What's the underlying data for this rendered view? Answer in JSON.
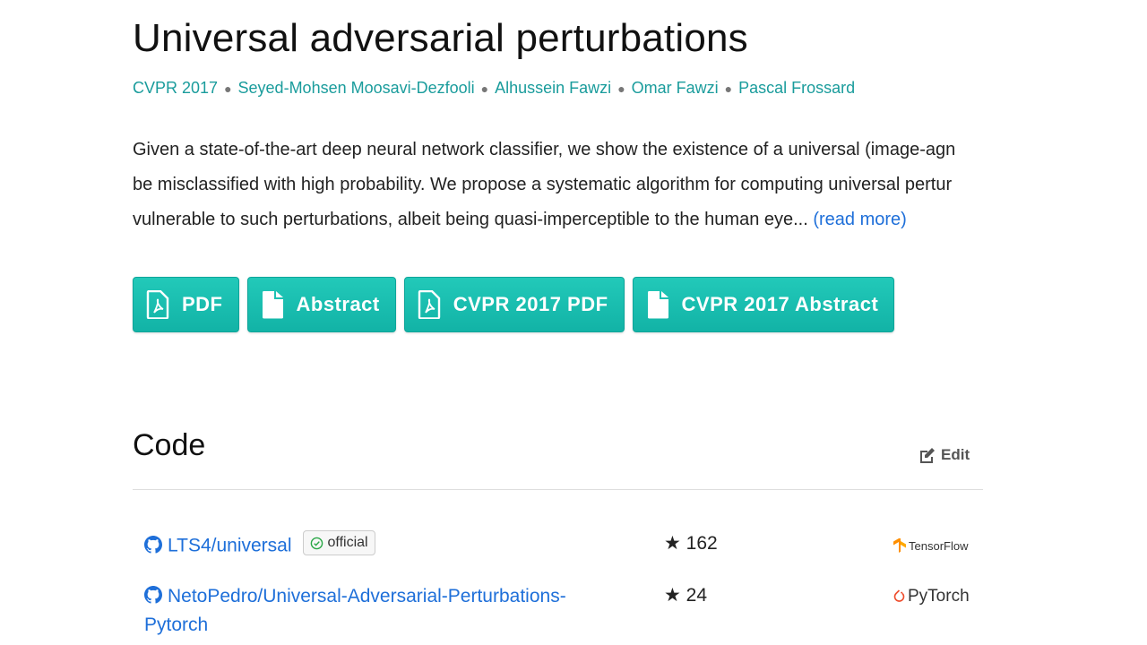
{
  "paper": {
    "title": "Universal adversarial perturbations",
    "conference": "CVPR 2017",
    "authors": [
      "Seyed-Mohsen Moosavi-Dezfooli",
      "Alhussein Fawzi",
      "Omar Fawzi",
      "Pascal Frossard"
    ],
    "abstract_lines": [
      "Given a state-of-the-art deep neural network classifier, we show the existence of a universal (image-agn",
      "be misclassified with high probability. We propose a systematic algorithm for computing universal pertur",
      "vulnerable to such perturbations, albeit being quasi-imperceptible to the human eye..."
    ],
    "read_more": "(read more)"
  },
  "buttons": [
    {
      "label": "PDF",
      "icon": "pdf-icon"
    },
    {
      "label": "Abstract",
      "icon": "file-icon"
    },
    {
      "label": "CVPR 2017 PDF",
      "icon": "pdf-icon"
    },
    {
      "label": "CVPR 2017 Abstract",
      "icon": "file-icon"
    }
  ],
  "code": {
    "heading": "Code",
    "edit_label": "Edit",
    "repos": [
      {
        "name": "LTS4/universal",
        "badge": "official",
        "stars": "162",
        "framework": "TensorFlow"
      },
      {
        "name_line1": "NetoPedro/Universal-Adversarial-Perturbations-",
        "name_line2": "Pytorch",
        "stars": "24",
        "framework": "PyTorch"
      }
    ]
  },
  "colors": {
    "accent": "#1a9c9c",
    "button": "#17b8aa",
    "link": "#1e6fd9"
  }
}
